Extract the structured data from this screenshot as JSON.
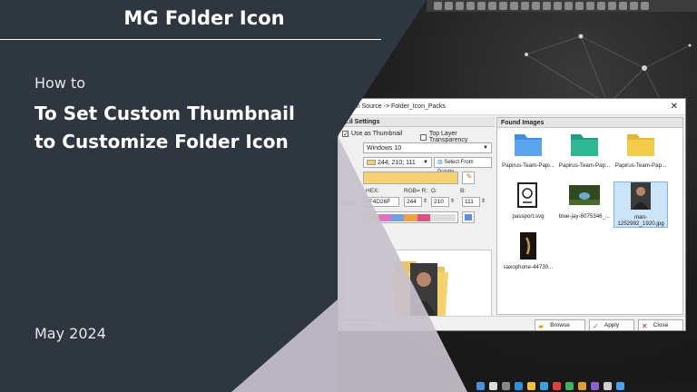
{
  "banner": {
    "app_title": "MG Folder Icon",
    "how_to": "How to",
    "headline_line1": "To Set Custom Thumbnail",
    "headline_line2": "to Customize Folder Icon",
    "date": "May 2024"
  },
  "dialog": {
    "title": "...om Source -> Folder_Icon_Packs",
    "close_glyph": "✕",
    "left_section_title": "...il Settings",
    "use_as_thumbnail_label": "Use as Thumbnail",
    "use_as_thumbnail_checked": true,
    "top_layer_transparency_label": "Top Layer Transparency",
    "top_layer_transparency_checked": false,
    "os_select": "Windows 10",
    "color_value_select": "244; 210; 111",
    "select_from_palette_label": "Select From Palette",
    "color_label": "Color:",
    "hex_label": "HEX:",
    "rgb_label": "RGB= R:",
    "g_label": "G:",
    "b_label": "B:",
    "hex_value": "#F4D26F",
    "r_value": "244",
    "g_value": "210",
    "b_value": "111",
    "accent_color": "#f4d26f",
    "switch_to_label": "Switch to...",
    "right_section_title": "Found Images",
    "found_images": [
      {
        "label": "Papirus-Team-Papi...",
        "icon": "folder-blue-icon"
      },
      {
        "label": "Papirus-Team-Pap...",
        "icon": "folder-teal-icon"
      },
      {
        "label": "Papirus-Team-Pap...",
        "icon": "folder-yellow-icon"
      },
      {
        "label": "passport.svg",
        "icon": "passport-icon"
      },
      {
        "label": "blue-jay-8075346_...",
        "icon": "bird-photo-icon"
      },
      {
        "label": "man-1252992_1920.jpg",
        "icon": "man-photo-icon",
        "selected": true
      },
      {
        "label": "saxophone-44730...",
        "icon": "saxophone-photo-icon"
      }
    ],
    "browse_label": "Browse",
    "apply_label": "Apply",
    "close_label": "Close"
  }
}
